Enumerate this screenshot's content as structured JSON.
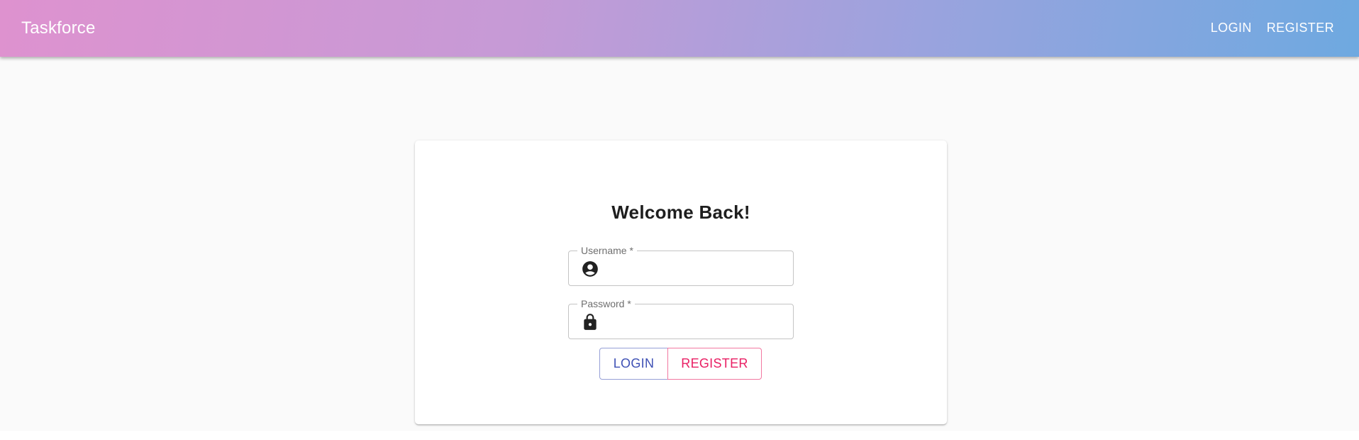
{
  "app_bar": {
    "brand": "Taskforce",
    "nav": [
      {
        "label": "LOGIN"
      },
      {
        "label": "REGISTER"
      }
    ],
    "gradient_colors": [
      "#de92cf",
      "#c69ad6",
      "#9aa3de",
      "#6ea9e0"
    ]
  },
  "login_card": {
    "title": "Welcome Back!",
    "username": {
      "label": "Username *",
      "value": "",
      "icon": "account-circle-icon"
    },
    "password": {
      "label": "Password *",
      "value": "",
      "icon": "lock-icon"
    },
    "buttons": {
      "login_label": "LOGIN",
      "register_label": "REGISTER",
      "login_color": "#3f51b5",
      "register_color": "#e91e63"
    }
  }
}
